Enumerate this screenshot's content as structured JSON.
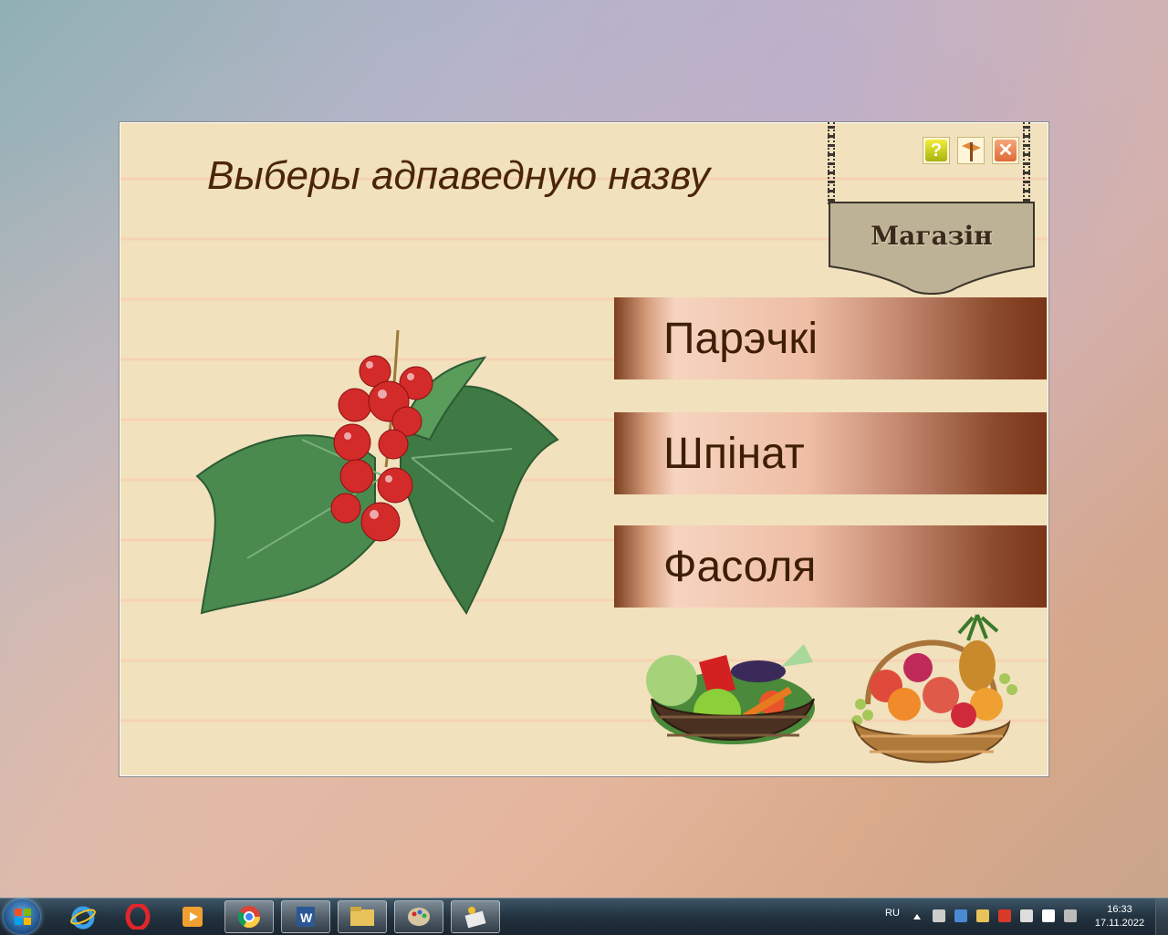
{
  "app": {
    "title": "Выберы адпаведную назву",
    "sign_label": "Магазін",
    "answers": [
      {
        "label": "Парэчкі"
      },
      {
        "label": "Шпінат"
      },
      {
        "label": "Фасоля"
      }
    ],
    "help_label": "?",
    "close_label": "✕"
  },
  "taskbar": {
    "apps": [
      "start-orb",
      "internet-explorer-icon",
      "opera-icon",
      "media-player-icon",
      "chrome-icon",
      "word-icon",
      "file-explorer-icon",
      "paint-icon",
      "app-icon"
    ],
    "language": "RU",
    "time": "16:33",
    "date": "17.11.2022"
  },
  "colors": {
    "title": "#4a2606",
    "answer_text": "#3e1e05",
    "background": "#f1e1bd"
  }
}
